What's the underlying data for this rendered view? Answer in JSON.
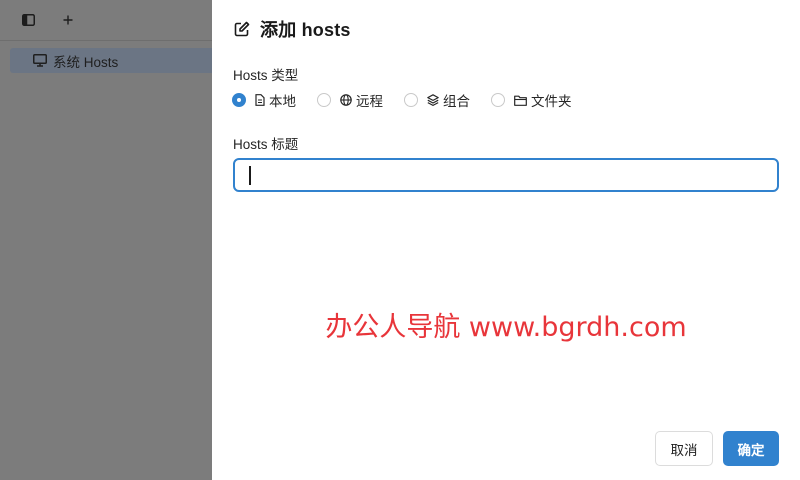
{
  "sidebar": {
    "toolbar": {
      "toggle_icon": "sidebar-toggle-icon",
      "add_icon": "plus-icon"
    },
    "items": [
      {
        "label": "系统 Hosts",
        "icon": "monitor-icon"
      }
    ]
  },
  "drawer": {
    "title": "添加 hosts",
    "title_icon": "edit-icon",
    "type_label": "Hosts 类型",
    "type_options": [
      {
        "label": "本地",
        "icon": "file-icon",
        "checked": true
      },
      {
        "label": "远程",
        "icon": "globe-icon",
        "checked": false
      },
      {
        "label": "组合",
        "icon": "layers-icon",
        "checked": false
      },
      {
        "label": "文件夹",
        "icon": "folder-icon",
        "checked": false
      }
    ],
    "hosts_title_label": "Hosts 标题",
    "hosts_title_value": "",
    "cancel_label": "取消",
    "ok_label": "确定"
  },
  "watermark": "办公人导航 www.bgrdh.com",
  "colors": {
    "accent": "#3182ce",
    "watermark": "#e8353a",
    "overlay": "#7f7f7f"
  }
}
